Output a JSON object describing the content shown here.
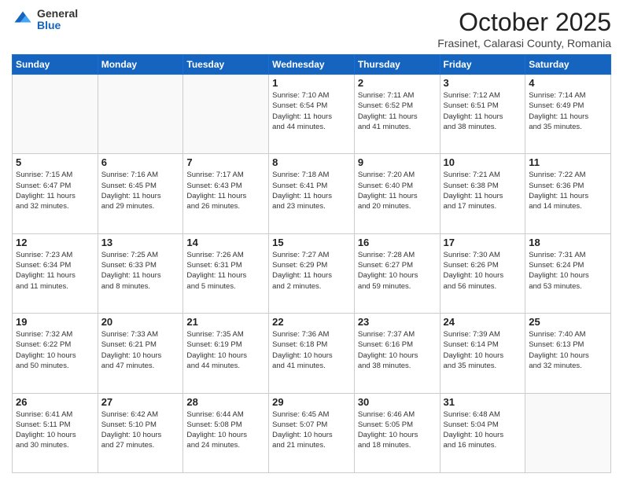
{
  "header": {
    "logo_general": "General",
    "logo_blue": "Blue",
    "month_title": "October 2025",
    "location": "Frasinet, Calarasi County, Romania"
  },
  "weekdays": [
    "Sunday",
    "Monday",
    "Tuesday",
    "Wednesday",
    "Thursday",
    "Friday",
    "Saturday"
  ],
  "weeks": [
    [
      {
        "day": "",
        "info": ""
      },
      {
        "day": "",
        "info": ""
      },
      {
        "day": "",
        "info": ""
      },
      {
        "day": "1",
        "info": "Sunrise: 7:10 AM\nSunset: 6:54 PM\nDaylight: 11 hours\nand 44 minutes."
      },
      {
        "day": "2",
        "info": "Sunrise: 7:11 AM\nSunset: 6:52 PM\nDaylight: 11 hours\nand 41 minutes."
      },
      {
        "day": "3",
        "info": "Sunrise: 7:12 AM\nSunset: 6:51 PM\nDaylight: 11 hours\nand 38 minutes."
      },
      {
        "day": "4",
        "info": "Sunrise: 7:14 AM\nSunset: 6:49 PM\nDaylight: 11 hours\nand 35 minutes."
      }
    ],
    [
      {
        "day": "5",
        "info": "Sunrise: 7:15 AM\nSunset: 6:47 PM\nDaylight: 11 hours\nand 32 minutes."
      },
      {
        "day": "6",
        "info": "Sunrise: 7:16 AM\nSunset: 6:45 PM\nDaylight: 11 hours\nand 29 minutes."
      },
      {
        "day": "7",
        "info": "Sunrise: 7:17 AM\nSunset: 6:43 PM\nDaylight: 11 hours\nand 26 minutes."
      },
      {
        "day": "8",
        "info": "Sunrise: 7:18 AM\nSunset: 6:41 PM\nDaylight: 11 hours\nand 23 minutes."
      },
      {
        "day": "9",
        "info": "Sunrise: 7:20 AM\nSunset: 6:40 PM\nDaylight: 11 hours\nand 20 minutes."
      },
      {
        "day": "10",
        "info": "Sunrise: 7:21 AM\nSunset: 6:38 PM\nDaylight: 11 hours\nand 17 minutes."
      },
      {
        "day": "11",
        "info": "Sunrise: 7:22 AM\nSunset: 6:36 PM\nDaylight: 11 hours\nand 14 minutes."
      }
    ],
    [
      {
        "day": "12",
        "info": "Sunrise: 7:23 AM\nSunset: 6:34 PM\nDaylight: 11 hours\nand 11 minutes."
      },
      {
        "day": "13",
        "info": "Sunrise: 7:25 AM\nSunset: 6:33 PM\nDaylight: 11 hours\nand 8 minutes."
      },
      {
        "day": "14",
        "info": "Sunrise: 7:26 AM\nSunset: 6:31 PM\nDaylight: 11 hours\nand 5 minutes."
      },
      {
        "day": "15",
        "info": "Sunrise: 7:27 AM\nSunset: 6:29 PM\nDaylight: 11 hours\nand 2 minutes."
      },
      {
        "day": "16",
        "info": "Sunrise: 7:28 AM\nSunset: 6:27 PM\nDaylight: 10 hours\nand 59 minutes."
      },
      {
        "day": "17",
        "info": "Sunrise: 7:30 AM\nSunset: 6:26 PM\nDaylight: 10 hours\nand 56 minutes."
      },
      {
        "day": "18",
        "info": "Sunrise: 7:31 AM\nSunset: 6:24 PM\nDaylight: 10 hours\nand 53 minutes."
      }
    ],
    [
      {
        "day": "19",
        "info": "Sunrise: 7:32 AM\nSunset: 6:22 PM\nDaylight: 10 hours\nand 50 minutes."
      },
      {
        "day": "20",
        "info": "Sunrise: 7:33 AM\nSunset: 6:21 PM\nDaylight: 10 hours\nand 47 minutes."
      },
      {
        "day": "21",
        "info": "Sunrise: 7:35 AM\nSunset: 6:19 PM\nDaylight: 10 hours\nand 44 minutes."
      },
      {
        "day": "22",
        "info": "Sunrise: 7:36 AM\nSunset: 6:18 PM\nDaylight: 10 hours\nand 41 minutes."
      },
      {
        "day": "23",
        "info": "Sunrise: 7:37 AM\nSunset: 6:16 PM\nDaylight: 10 hours\nand 38 minutes."
      },
      {
        "day": "24",
        "info": "Sunrise: 7:39 AM\nSunset: 6:14 PM\nDaylight: 10 hours\nand 35 minutes."
      },
      {
        "day": "25",
        "info": "Sunrise: 7:40 AM\nSunset: 6:13 PM\nDaylight: 10 hours\nand 32 minutes."
      }
    ],
    [
      {
        "day": "26",
        "info": "Sunrise: 6:41 AM\nSunset: 5:11 PM\nDaylight: 10 hours\nand 30 minutes."
      },
      {
        "day": "27",
        "info": "Sunrise: 6:42 AM\nSunset: 5:10 PM\nDaylight: 10 hours\nand 27 minutes."
      },
      {
        "day": "28",
        "info": "Sunrise: 6:44 AM\nSunset: 5:08 PM\nDaylight: 10 hours\nand 24 minutes."
      },
      {
        "day": "29",
        "info": "Sunrise: 6:45 AM\nSunset: 5:07 PM\nDaylight: 10 hours\nand 21 minutes."
      },
      {
        "day": "30",
        "info": "Sunrise: 6:46 AM\nSunset: 5:05 PM\nDaylight: 10 hours\nand 18 minutes."
      },
      {
        "day": "31",
        "info": "Sunrise: 6:48 AM\nSunset: 5:04 PM\nDaylight: 10 hours\nand 16 minutes."
      },
      {
        "day": "",
        "info": ""
      }
    ]
  ]
}
